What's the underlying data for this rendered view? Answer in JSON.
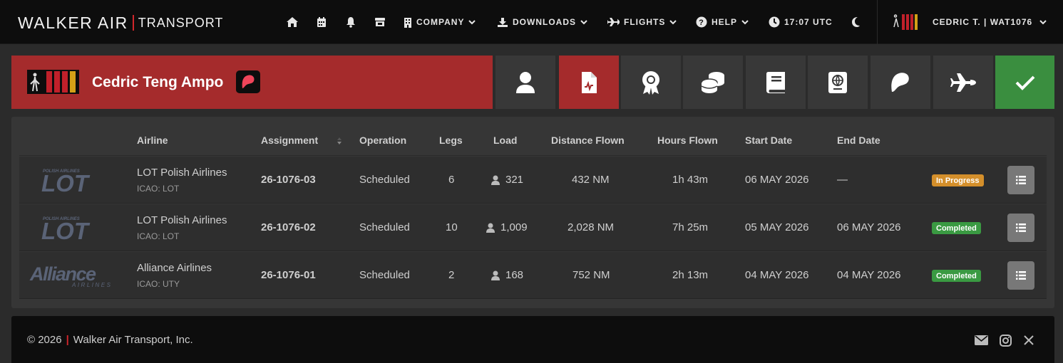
{
  "brand": {
    "main": "WALKER AIR",
    "sub": "TRANSPORT"
  },
  "nav": {
    "company": "COMPANY",
    "downloads": "DOWNLOADS",
    "flights": "FLIGHTS",
    "help": "HELP",
    "time": "17:07 UTC",
    "user": "CEDRIC T. | WAT1076"
  },
  "profile": {
    "name": "Cedric Teng Ampo"
  },
  "table": {
    "headers": [
      "Airline",
      "Assignment",
      "Operation",
      "Legs",
      "Load",
      "Distance Flown",
      "Hours Flown",
      "Start Date",
      "End Date"
    ],
    "rows": [
      {
        "airline": "LOT Polish Airlines",
        "icao": "ICAO: LOT",
        "assignment": "26-1076-03",
        "operation": "Scheduled",
        "legs": "6",
        "load": "321",
        "distance": "432 NM",
        "hours": "1h 43m",
        "start": "06 MAY 2026",
        "end": "—",
        "status": "In Progress"
      },
      {
        "airline": "LOT Polish Airlines",
        "icao": "ICAO: LOT",
        "assignment": "26-1076-02",
        "operation": "Scheduled",
        "legs": "10",
        "load": "1,009",
        "distance": "2,028 NM",
        "hours": "7h 25m",
        "start": "05 MAY 2026",
        "end": "06 MAY 2026",
        "status": "Completed"
      },
      {
        "airline": "Alliance Airlines",
        "icao": "ICAO: UTY",
        "assignment": "26-1076-01",
        "operation": "Scheduled",
        "legs": "2",
        "load": "168",
        "distance": "752 NM",
        "hours": "2h 13m",
        "start": "04 MAY 2026",
        "end": "04 MAY 2026",
        "status": "Completed"
      }
    ]
  },
  "logos": {
    "lot_small": "POLISH AIRLINES",
    "lot_main": "LOT",
    "alliance_main": "Alliance",
    "alliance_sub": "AIRLINES"
  },
  "footer": {
    "year": "© 2026",
    "company": "Walker Air Transport, Inc."
  },
  "colors": {
    "accent_red": "#a52b2c",
    "confirm_green": "#3a8e3f",
    "in_progress": "#d48f2b",
    "completed": "#3a9a42"
  }
}
